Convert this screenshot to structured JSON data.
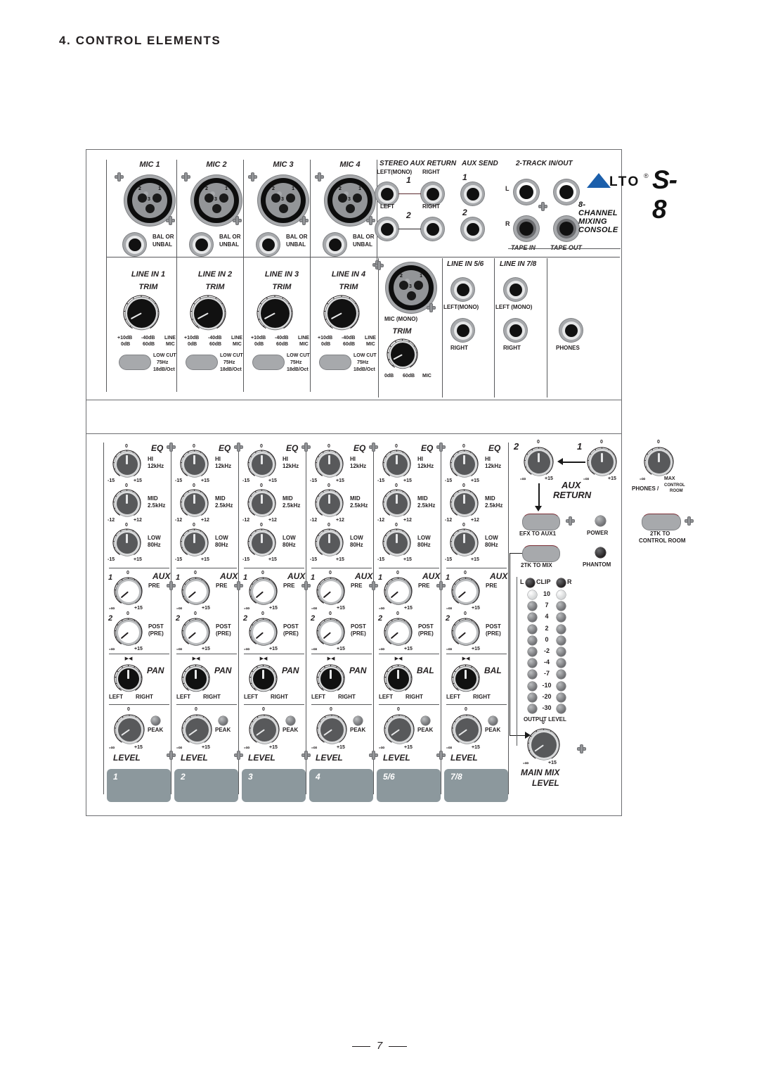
{
  "document": {
    "section_title": "4. CONTROL ELEMENTS",
    "page_number": "7"
  },
  "brand": {
    "logo_text": "LTO",
    "registered": "®",
    "model": "S-8",
    "tagline": "8-CHANNEL MIXING CONSOLE"
  },
  "top_panel": {
    "mic_channels": [
      {
        "title": "MIC 1",
        "jack_label": "BAL OR\nUNBAL",
        "line_label": "LINE IN 1"
      },
      {
        "title": "MIC 2",
        "jack_label": "BAL OR\nUNBAL",
        "line_label": "LINE IN 2"
      },
      {
        "title": "MIC 3",
        "jack_label": "BAL OR\nUNBAL",
        "line_label": "LINE IN 3"
      },
      {
        "title": "MIC 4",
        "jack_label": "BAL OR\nUNBAL",
        "line_label": "LINE IN 4"
      }
    ],
    "xlr_pins": [
      "1",
      "2",
      "3"
    ],
    "trim": {
      "title": "TRIM",
      "scale_top_left": "+10dB",
      "scale_top_right": "-40dB",
      "scale_top_far": "LINE",
      "scale_bot_left": "0dB",
      "scale_bot_right": "60dB",
      "scale_bot_far": "MIC"
    },
    "low_cut": {
      "line1": "LOW CUT",
      "line2": "75Hz",
      "line3": "18dB/Oct"
    },
    "stereo_aux_return": {
      "title": "STEREO AUX RETURN",
      "row1": {
        "num": "1",
        "left": "LEFT(MONO)",
        "right": "RIGHT"
      },
      "row2": {
        "num": "2",
        "left": "LEFT",
        "right": "RIGHT"
      }
    },
    "aux_send": {
      "title": "AUX SEND",
      "items": [
        "1",
        "2"
      ]
    },
    "two_track": {
      "title": "2-TRACK IN/OUT",
      "row_l": "L",
      "row_r": "R",
      "tape_in": "TAPE IN",
      "tape_out": "TAPE OUT"
    },
    "mono_mic": {
      "label": "MIC (MONO)",
      "trim_title": "TRIM",
      "scale_left": "0dB",
      "scale_mid": "60dB",
      "scale_right": "MIC"
    },
    "line_in_56": {
      "title": "LINE IN 5/6",
      "left": "LEFT(MONO)",
      "right": "RIGHT"
    },
    "line_in_78": {
      "title": "LINE IN 7/8",
      "left": "LEFT (MONO)",
      "right": "RIGHT"
    },
    "phones_jack": "PHONES"
  },
  "channel_strip": {
    "eq_title": "EQ",
    "eq_bands": [
      {
        "name": "HI",
        "freq": "12kHz",
        "min": "-15",
        "max": "+15",
        "center": "0"
      },
      {
        "name": "MID",
        "freq": "2.5kHz",
        "min": "-12",
        "max": "+12",
        "center": "0"
      },
      {
        "name": "LOW",
        "freq": "80Hz",
        "min": "-15",
        "max": "+15",
        "center": "0"
      }
    ],
    "aux_title": "AUX",
    "aux_sends": [
      {
        "num": "1",
        "mode": "PRE",
        "mode2": "",
        "min": "-∞",
        "max": "+15",
        "center": "0"
      },
      {
        "num": "2",
        "mode": "POST",
        "mode2": "(PRE)",
        "min": "-∞",
        "max": "+15",
        "center": "0"
      }
    ],
    "pan_title": "PAN",
    "bal_title": "BAL",
    "pan_left": "LEFT",
    "pan_right": "RIGHT",
    "level_title": "LEVEL",
    "level_min": "-∞",
    "level_max": "+15",
    "level_center": "0",
    "peak_label": "PEAK",
    "channels": [
      {
        "plate": "1",
        "pan_mode": "PAN"
      },
      {
        "plate": "2",
        "pan_mode": "PAN"
      },
      {
        "plate": "3",
        "pan_mode": "PAN"
      },
      {
        "plate": "4",
        "pan_mode": "PAN"
      },
      {
        "plate": "5/6",
        "pan_mode": "BAL"
      },
      {
        "plate": "7/8",
        "pan_mode": "BAL"
      }
    ]
  },
  "master": {
    "aux_return_title": "AUX",
    "aux_return_title2": "RETURN",
    "aux_return_knobs": [
      {
        "num": "2",
        "min": "-∞",
        "max": "+15",
        "center": "0"
      },
      {
        "num": "1",
        "min": "-∞",
        "max": "+15",
        "center": "0"
      }
    ],
    "phones_knob": {
      "min": "-∞",
      "max": "MAX",
      "center": "0",
      "label1": "PHONES /",
      "label2a": "CONTROL",
      "label2b": "ROOM"
    },
    "buttons": [
      {
        "name": "EFX TO AUX1",
        "line1": "EFX TO AUX1",
        "line2": ""
      },
      {
        "name": "2TK TO MIX",
        "line1": "2TK TO MIX",
        "line2": ""
      },
      {
        "name": "2TK TO CONTROL ROOM",
        "line1": "2TK TO",
        "line2": "CONTROL ROOM"
      }
    ],
    "indicators": [
      {
        "label": "POWER",
        "style": "grey"
      },
      {
        "label": "PHANTOM",
        "style": "dark"
      }
    ],
    "meter": {
      "left_label": "L",
      "clip_label": "CLIP",
      "right_label": "R",
      "scale": [
        "10",
        "7",
        "4",
        "2",
        "0",
        "-2",
        "-4",
        "-7",
        "-10",
        "-20",
        "-30"
      ],
      "caption": "OUTPUT LEVEL"
    },
    "main_mix": {
      "title": "MAIN MIX",
      "subtitle": "LEVEL",
      "min": "-∞",
      "max": "+15",
      "center": "0"
    }
  },
  "colors": {
    "panel_border": "#6d6e71",
    "knob_grey": "#58595b",
    "knob_black": "#111111",
    "plate": "#8c989d",
    "brand_blue": "#1b5fab",
    "text": "#231f20"
  }
}
